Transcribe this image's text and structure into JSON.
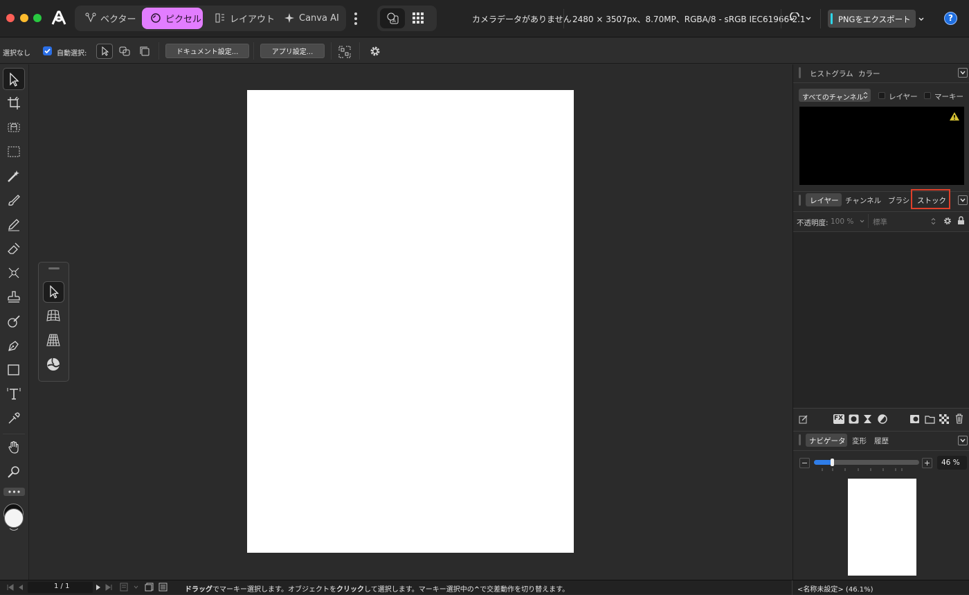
{
  "titlebar": {
    "personas": [
      {
        "label": "ベクター"
      },
      {
        "label": "ピクセル"
      },
      {
        "label": "レイアウト"
      },
      {
        "label": "Canva AI"
      }
    ],
    "camera_info": "カメラデータがありません",
    "doc_info": "2480 × 3507px、8.70MP、RGBA/8 - sRGB IEC61966-2.1",
    "export_label": "PNGをエクスポート",
    "help_label": "?"
  },
  "context_toolbar": {
    "selection_label": "選択なし",
    "auto_select_label": "自動選択:",
    "auto_select_checked": true,
    "doc_settings_label": "ドキュメント設定...",
    "app_settings_label": "アプリ設定..."
  },
  "right_panel": {
    "top_tabs": [
      "ヒストグラム",
      "カラー"
    ],
    "channel_select": "すべてのチャンネル",
    "layer_check_label": "レイヤー",
    "marquee_check_label": "マーキー",
    "layer_tabs": [
      "レイヤー",
      "チャンネル",
      "ブラシ",
      "ストック"
    ],
    "opacity_label": "不透明度:",
    "opacity_value": "100 %",
    "blend_mode": "標準",
    "fx_label": "FX",
    "nav_tabs": [
      "ナビゲータ",
      "変形",
      "履歴"
    ],
    "zoom_value": "46 %",
    "zoom_fraction": 0.17
  },
  "statusbar": {
    "page_indicator": "1 / 1",
    "hint_drag": "ドラッグ",
    "hint_part1": "でマーキー選択します。オブジェクトを",
    "hint_click": "クリック",
    "hint_part2": "して選択します。マーキー選択中の",
    "hint_key": "^",
    "hint_part3": "で交差動作を切り替えます。",
    "doc_name": "<名称未設定> (46.1%)"
  },
  "colors": {
    "accent_pixel_persona": "#e27dff",
    "export_accent": "#2fd6e8",
    "help_blue": "#1f6fe0",
    "highlight_red": "#e0402a",
    "slider_blue": "#2f7de8"
  }
}
